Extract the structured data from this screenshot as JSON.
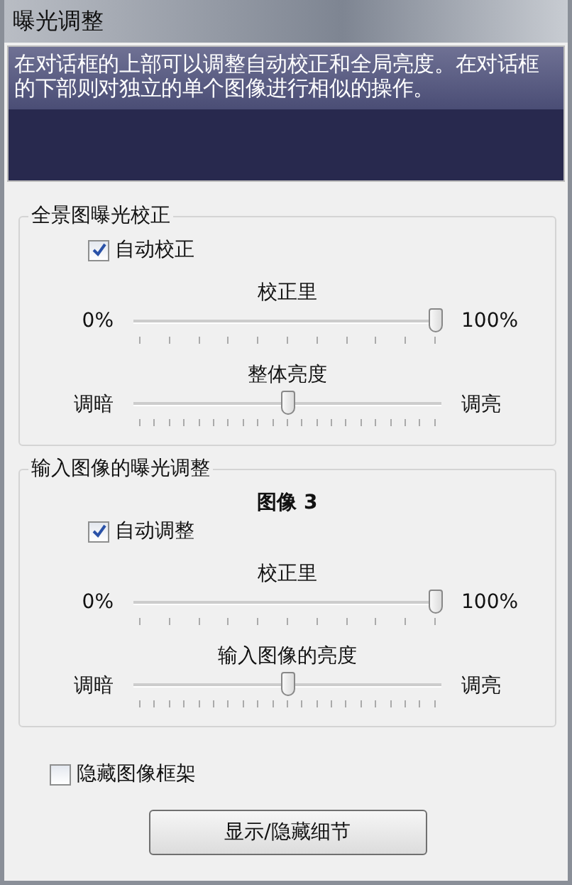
{
  "window": {
    "title": "曝光调整"
  },
  "description": "在对话框的上部可以调整自动校正和全局亮度。在对话框的下部则对独立的单个图像进行相似的操作。",
  "groups": [
    {
      "title": "全景图曝光校正",
      "checkbox": {
        "label": "自动校正",
        "checked": true
      },
      "sliders": [
        {
          "kind": "fine",
          "label": "校正里",
          "min_label": "0%",
          "max_label": "100%",
          "level": 0.98
        },
        {
          "kind": "coarse",
          "label": "整体亮度",
          "min_label": "调暗",
          "max_label": "调亮",
          "level": 0.5
        }
      ]
    },
    {
      "title": "输入图像的曝光调整",
      "subtitle": "图像 3",
      "checkbox": {
        "label": "自动调整",
        "checked": true
      },
      "sliders": [
        {
          "kind": "fine",
          "label": "校正里",
          "min_label": "0%",
          "max_label": "100%",
          "level": 0.98
        },
        {
          "kind": "coarse",
          "label": "输入图像的亮度",
          "min_label": "调暗",
          "max_label": "调亮",
          "level": 0.5
        }
      ]
    }
  ],
  "hide_frames": {
    "label": "隐藏图像框架",
    "checked": false
  },
  "buttons": [
    {
      "label": "显示/隐藏细节"
    }
  ]
}
